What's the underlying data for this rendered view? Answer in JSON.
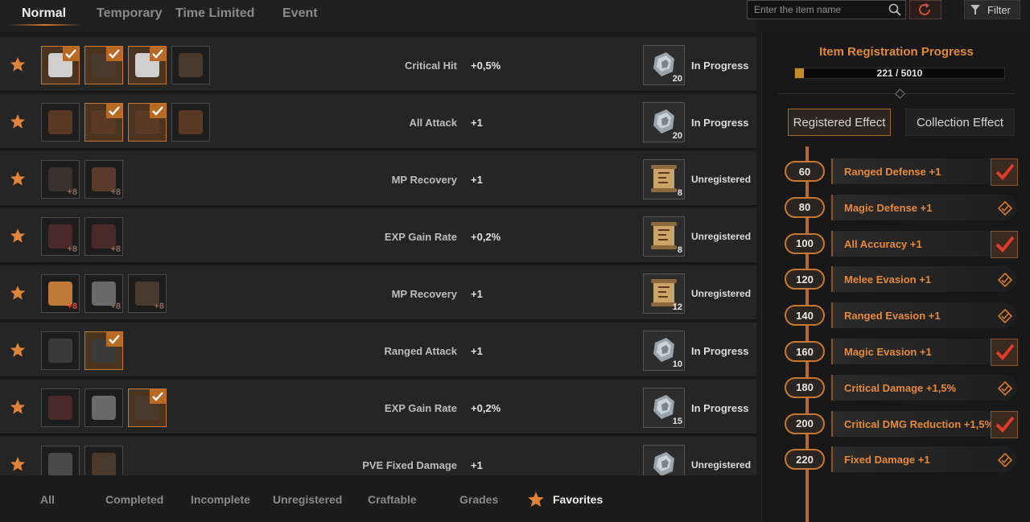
{
  "top_tabs": [
    {
      "label": "Normal",
      "active": true
    },
    {
      "label": "Temporary",
      "active": false
    },
    {
      "label": "Time Limited",
      "active": false
    },
    {
      "label": "Event",
      "active": false
    }
  ],
  "search": {
    "placeholder": "Enter the item name"
  },
  "filter_label": "Filter",
  "collection_rows": [
    {
      "stat": "Critical Hit",
      "value": "+0,5%",
      "reward_count": "20",
      "reward_icon": "ore-icon",
      "status": "In Progress",
      "slots": [
        {
          "icon": "shirt-icon",
          "registered": true,
          "plus": ""
        },
        {
          "icon": "armor-icon",
          "registered": true,
          "plus": ""
        },
        {
          "icon": "shirt-icon",
          "registered": true,
          "plus": ""
        },
        {
          "icon": "armor-icon",
          "registered": false,
          "plus": ""
        }
      ]
    },
    {
      "stat": "All Attack",
      "value": "+1",
      "reward_count": "20",
      "reward_icon": "ore-icon",
      "status": "In Progress",
      "slots": [
        {
          "icon": "belt-icon",
          "registered": false,
          "plus": ""
        },
        {
          "icon": "belt-icon",
          "registered": true,
          "plus": ""
        },
        {
          "icon": "belt-icon",
          "registered": true,
          "plus": ""
        },
        {
          "icon": "belt-icon",
          "registered": false,
          "plus": ""
        }
      ]
    },
    {
      "stat": "MP Recovery",
      "value": "+1",
      "reward_count": "8",
      "reward_icon": "scroll-icon",
      "status": "Unregistered",
      "slots": [
        {
          "icon": "pants-icon",
          "registered": false,
          "plus": "+8"
        },
        {
          "icon": "boots-icon",
          "registered": false,
          "plus": "+8"
        }
      ]
    },
    {
      "stat": "EXP Gain Rate",
      "value": "+0,2%",
      "reward_count": "8",
      "reward_icon": "scroll-icon",
      "status": "Unregistered",
      "slots": [
        {
          "icon": "glove-icon",
          "registered": false,
          "plus": "+8"
        },
        {
          "icon": "glove-icon",
          "registered": false,
          "plus": "+8"
        }
      ]
    },
    {
      "stat": "MP Recovery",
      "value": "+1",
      "reward_count": "12",
      "reward_icon": "scroll-icon",
      "status": "Unregistered",
      "slots": [
        {
          "icon": "bracer-icon",
          "registered": false,
          "plus": "+8",
          "plus_red": true
        },
        {
          "icon": "helmet-icon",
          "registered": false,
          "plus": "+8"
        },
        {
          "icon": "armor-icon",
          "registered": false,
          "plus": "+8"
        }
      ]
    },
    {
      "stat": "Ranged Attack",
      "value": "+1",
      "reward_count": "10",
      "reward_icon": "ore-icon",
      "status": "In Progress",
      "slots": [
        {
          "icon": "bow-icon",
          "registered": false,
          "plus": ""
        },
        {
          "icon": "bow-icon",
          "registered": true,
          "plus": ""
        }
      ]
    },
    {
      "stat": "EXP Gain Rate",
      "value": "+0,2%",
      "reward_count": "15",
      "reward_icon": "ore-icon",
      "status": "In Progress",
      "slots": [
        {
          "icon": "glove-icon",
          "registered": false,
          "plus": ""
        },
        {
          "icon": "helmet-icon",
          "registered": false,
          "plus": ""
        },
        {
          "icon": "armor-icon",
          "registered": true,
          "plus": ""
        }
      ]
    },
    {
      "stat": "PVE Fixed Damage",
      "value": "+1",
      "reward_count": "",
      "reward_icon": "ore-icon",
      "status": "Unregistered",
      "slots": [
        {
          "icon": "dagger-icon",
          "registered": false,
          "plus": ""
        },
        {
          "icon": "armor-icon",
          "registered": false,
          "plus": ""
        }
      ]
    }
  ],
  "bottom_tabs": [
    {
      "label": "All",
      "active": false
    },
    {
      "label": "Completed",
      "active": false
    },
    {
      "label": "Incomplete",
      "active": false
    },
    {
      "label": "Unregistered",
      "active": false
    },
    {
      "label": "Craftable",
      "active": false
    },
    {
      "label": "Grades",
      "active": false
    },
    {
      "label": "Favorites",
      "active": true
    }
  ],
  "panel": {
    "title": "Item Registration Progress",
    "progress_text": "221 / 5010",
    "progress_value": 221,
    "progress_max": 5010,
    "tab_registered": "Registered Effect",
    "tab_collection": "Collection Effect",
    "milestones": [
      {
        "level": "60",
        "effect": "Ranged Defense +1",
        "achieved": true
      },
      {
        "level": "80",
        "effect": "Magic Defense +1",
        "achieved": false
      },
      {
        "level": "100",
        "effect": "All Accuracy +1",
        "achieved": true
      },
      {
        "level": "120",
        "effect": "Melee Evasion +1",
        "achieved": false
      },
      {
        "level": "140",
        "effect": "Ranged Evasion +1",
        "achieved": false
      },
      {
        "level": "160",
        "effect": "Magic Evasion +1",
        "achieved": true
      },
      {
        "level": "180",
        "effect": "Critical Damage +1,5%",
        "achieved": false
      },
      {
        "level": "200",
        "effect": "Critical DMG Reduction +1,5%",
        "achieved": true
      },
      {
        "level": "220",
        "effect": "Fixed Damage +1",
        "achieved": false
      }
    ]
  },
  "colors": {
    "accent": "#d47a2c",
    "star": "#e0843a",
    "check": "#e23a2a"
  }
}
